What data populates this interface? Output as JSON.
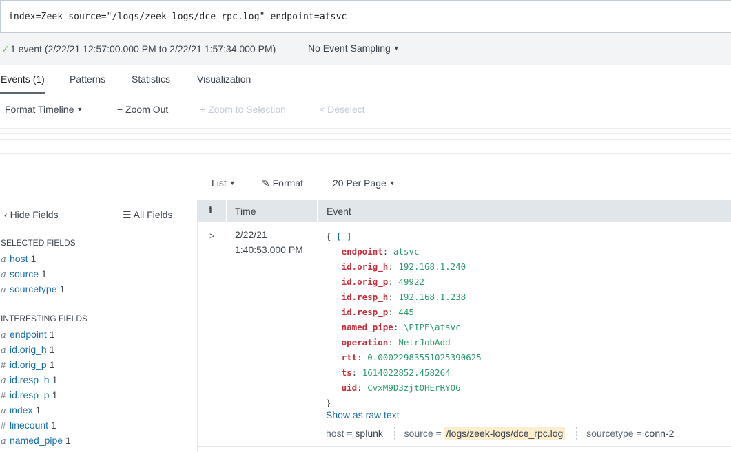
{
  "search": {
    "query": "index=Zeek source=\"/logs/zeek-logs/dce_rpc.log\" endpoint=atsvc"
  },
  "status": {
    "check_icon": "check-icon",
    "summary": "1 event (2/22/21 12:57:00.000 PM to 2/22/21 1:57:34.000 PM)",
    "sampling": "No Event Sampling"
  },
  "tabs": [
    {
      "label": "Events (1)",
      "active": true
    },
    {
      "label": "Patterns"
    },
    {
      "label": "Statistics"
    },
    {
      "label": "Visualization"
    }
  ],
  "timeline_toolbar": {
    "format_timeline": "Format Timeline",
    "zoom_out": "Zoom Out",
    "zoom_to_selection": "Zoom to Selection",
    "deselect": "Deselect"
  },
  "list_toolbar": {
    "list": "List",
    "format": "Format",
    "per_page": "20 Per Page"
  },
  "fields_panel": {
    "hide_fields": "Hide Fields",
    "all_fields": "All Fields",
    "selected_heading": "SELECTED FIELDS",
    "selected": [
      {
        "type": "a",
        "name": "host",
        "count": "1"
      },
      {
        "type": "a",
        "name": "source",
        "count": "1"
      },
      {
        "type": "a",
        "name": "sourcetype",
        "count": "1"
      }
    ],
    "interesting_heading": "INTERESTING FIELDS",
    "interesting": [
      {
        "type": "a",
        "name": "endpoint",
        "count": "1"
      },
      {
        "type": "a",
        "name": "id.orig_h",
        "count": "1"
      },
      {
        "type": "#",
        "name": "id.orig_p",
        "count": "1"
      },
      {
        "type": "a",
        "name": "id.resp_h",
        "count": "1"
      },
      {
        "type": "#",
        "name": "id.resp_p",
        "count": "1"
      },
      {
        "type": "a",
        "name": "index",
        "count": "1"
      },
      {
        "type": "#",
        "name": "linecount",
        "count": "1"
      },
      {
        "type": "a",
        "name": "named_pipe",
        "count": "1"
      }
    ]
  },
  "table": {
    "col_info": "i",
    "col_time": "Time",
    "col_event": "Event"
  },
  "event": {
    "date": "2/22/21",
    "time": "1:40:53.000 PM",
    "open_brace": "{",
    "collapse": "[-]",
    "close_brace": "}",
    "fields": [
      {
        "key": "endpoint",
        "value": "atsvc"
      },
      {
        "key": "id.orig_h",
        "value": "192.168.1.240"
      },
      {
        "key": "id.orig_p",
        "value": "49922"
      },
      {
        "key": "id.resp_h",
        "value": "192.168.1.238"
      },
      {
        "key": "id.resp_p",
        "value": "445"
      },
      {
        "key": "named_pipe",
        "value": "\\PIPE\\atsvc"
      },
      {
        "key": "operation",
        "value": "NetrJobAdd"
      },
      {
        "key": "rtt",
        "value": "0.00022983551025390625"
      },
      {
        "key": "ts",
        "value": "1614022852.458264"
      },
      {
        "key": "uid",
        "value": "CvxM9D3zjt0HErRYO6"
      }
    ],
    "show_raw": "Show as raw text",
    "meta": {
      "host_key": "host =",
      "host_val": "splunk",
      "source_key": "source =",
      "source_val": "/logs/zeek-logs/dce_rpc.log",
      "sourcetype_key": "sourcetype =",
      "sourcetype_val": "conn-2"
    }
  },
  "colors": {
    "accent_link": "#1a6fa8",
    "json_key": "#c2313c",
    "json_value": "#2f9b6d",
    "success": "#5cc05c"
  }
}
